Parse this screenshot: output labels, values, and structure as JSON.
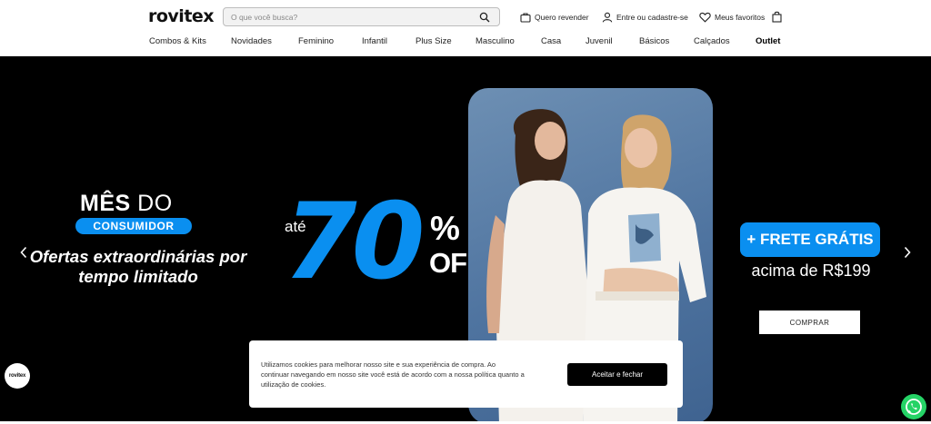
{
  "header": {
    "logo": "rovitex",
    "search_placeholder": "O que você busca?",
    "quero_revender": "Quero revender",
    "entrar": "Entre ou cadastre-se",
    "favoritos": "Meus favoritos"
  },
  "nav": [
    "Combos & Kits",
    "Novidades",
    "Feminino",
    "Infantil",
    "Plus Size",
    "Masculino",
    "Casa",
    "Juvenil",
    "Básicos",
    "Calçados",
    "Outlet"
  ],
  "hero": {
    "mes": "MÊS",
    "do": "DO",
    "consumidor": "CONSUMIDOR",
    "ofertas": "Ofertas extraordinárias por tempo limitado",
    "ate": "até",
    "percent_value": "70",
    "percent_sign": "%",
    "off": "OFF",
    "frete": "+ FRETE GRÁTIS",
    "acima": "acima de R$199",
    "comprar": "COMPRAR"
  },
  "cookie": {
    "text": "Utilizamos cookies para melhorar nosso site e sua experiência de compra. Ao continuar navegando em nosso site você está de acordo com a nossa política quanto a utilização de cookies.",
    "accept": "Aceitar e fechar"
  },
  "badge_logo": "rovitex",
  "colors": {
    "accent": "#0a8ff0",
    "background": "#000000",
    "whatsapp": "#25d366"
  },
  "icons": [
    "search-icon",
    "bag-icon",
    "user-icon",
    "heart-icon",
    "cart-icon",
    "chevron-left-icon",
    "chevron-right-icon",
    "whatsapp-icon"
  ]
}
